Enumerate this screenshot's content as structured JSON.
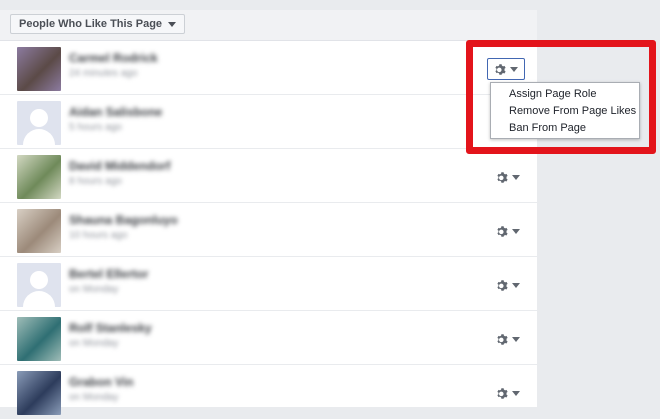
{
  "header": {
    "filter_label": "People Who Like This Page"
  },
  "people": [
    {
      "name": "Carmel Rodrick",
      "time": "24 minutes ago",
      "avatar": "photo",
      "colors": [
        "#5b4a47",
        "#8c7ba0"
      ]
    },
    {
      "name": "Aidan Salisbone",
      "time": "5 hours ago",
      "avatar": "default",
      "colors": [
        "#dfe3ee",
        "#dfe3ee"
      ]
    },
    {
      "name": "David Middendorf",
      "time": "8 hours ago",
      "avatar": "photo",
      "colors": [
        "#6f8a5a",
        "#d2d8c2"
      ]
    },
    {
      "name": "Shauna Bagonluyo",
      "time": "10 hours ago",
      "avatar": "photo",
      "colors": [
        "#9c8a7a",
        "#d8cfc4"
      ]
    },
    {
      "name": "Bertel Ellertor",
      "time": "on Monday",
      "avatar": "default",
      "colors": [
        "#dfe3ee",
        "#dfe3ee"
      ]
    },
    {
      "name": "Rolf Stanlesky",
      "time": "on Monday",
      "avatar": "photo",
      "colors": [
        "#2f6f73",
        "#9fbdb8"
      ]
    },
    {
      "name": "Grabon Vin",
      "time": "on Monday",
      "avatar": "photo",
      "colors": [
        "#2d3c5c",
        "#8a9cb8"
      ]
    }
  ],
  "menu": {
    "items": [
      "Assign Page Role",
      "Remove From Page Likes",
      "Ban From Page"
    ]
  },
  "colors": {
    "highlight": "#e3141b",
    "accent": "#4267b2"
  }
}
